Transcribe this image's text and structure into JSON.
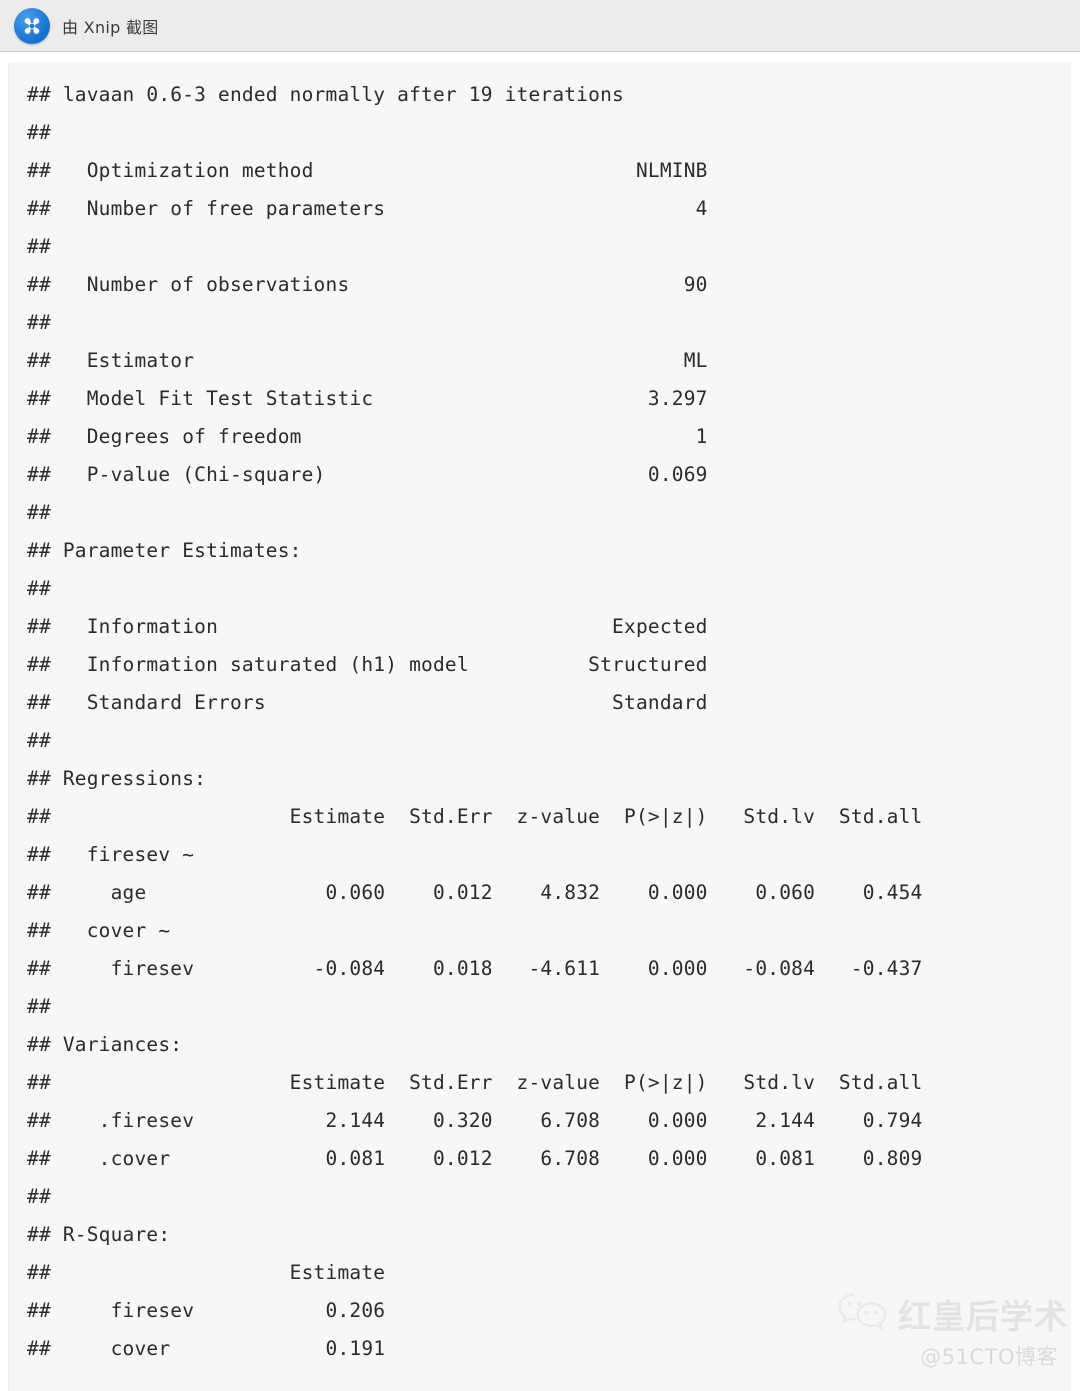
{
  "window": {
    "app_title": "由 Xnip 截图",
    "logo_icon": "xnip-scissors-icon",
    "header_bg": "#ececec",
    "code_bg": "#f7f7f7",
    "text_color": "#2b2b2b"
  },
  "console_output": {
    "language": "r",
    "comment_prefix": "##",
    "lines": [
      "## lavaan 0.6-3 ended normally after 19 iterations",
      "## ",
      "##   Optimization method                           NLMINB",
      "##   Number of free parameters                          4",
      "## ",
      "##   Number of observations                            90",
      "## ",
      "##   Estimator                                         ML",
      "##   Model Fit Test Statistic                       3.297",
      "##   Degrees of freedom                                 1",
      "##   P-value (Chi-square)                           0.069",
      "## ",
      "## Parameter Estimates:",
      "## ",
      "##   Information                                 Expected",
      "##   Information saturated (h1) model          Structured",
      "##   Standard Errors                             Standard",
      "## ",
      "## Regressions:",
      "##                    Estimate  Std.Err  z-value  P(>|z|)   Std.lv  Std.all",
      "##   firesev ~",
      "##     age               0.060    0.012    4.832    0.000    0.060    0.454",
      "##   cover ~",
      "##     firesev          -0.084    0.018   -4.611    0.000   -0.084   -0.437",
      "## ",
      "## Variances:",
      "##                    Estimate  Std.Err  z-value  P(>|z|)   Std.lv  Std.all",
      "##    .firesev           2.144    0.320    6.708    0.000    2.144    0.794",
      "##    .cover             0.081    0.012    6.708    0.000    0.081    0.809",
      "## ",
      "## R-Square:",
      "##                    Estimate",
      "##     firesev           0.206",
      "##     cover             0.191"
    ]
  },
  "model_summary": {
    "package": "lavaan",
    "version": "0.6-3",
    "convergence": "ended normally",
    "iterations": 19,
    "optimization_method": "NLMINB",
    "number_of_free_parameters": 4,
    "number_of_observations": 90,
    "estimator": "ML",
    "model_fit_test_statistic": 3.297,
    "degrees_of_freedom": 1,
    "p_value_chi_square": 0.069,
    "information": "Expected",
    "information_saturated_h1_model": "Structured",
    "standard_errors": "Standard"
  },
  "tables": {
    "regressions": {
      "heading": "Regressions:",
      "columns": [
        "Estimate",
        "Std.Err",
        "z-value",
        "P(>|z|)",
        "Std.lv",
        "Std.all"
      ],
      "groups": [
        {
          "label": "firesev ~",
          "rows": [
            {
              "name": "age",
              "values": [
                "0.060",
                "0.012",
                "4.832",
                "0.000",
                "0.060",
                "0.454"
              ]
            }
          ]
        },
        {
          "label": "cover ~",
          "rows": [
            {
              "name": "firesev",
              "values": [
                "-0.084",
                "0.018",
                "-4.611",
                "0.000",
                "-0.084",
                "-0.437"
              ]
            }
          ]
        }
      ]
    },
    "variances": {
      "heading": "Variances:",
      "columns": [
        "Estimate",
        "Std.Err",
        "z-value",
        "P(>|z|)",
        "Std.lv",
        "Std.all"
      ],
      "rows": [
        {
          "name": ".firesev",
          "values": [
            "2.144",
            "0.320",
            "6.708",
            "0.000",
            "2.144",
            "0.794"
          ]
        },
        {
          "name": ".cover",
          "values": [
            "0.081",
            "0.012",
            "6.708",
            "0.000",
            "0.081",
            "0.809"
          ]
        }
      ]
    },
    "r_square": {
      "heading": "R-Square:",
      "columns": [
        "Estimate"
      ],
      "rows": [
        {
          "name": "firesev",
          "values": [
            "0.206"
          ]
        },
        {
          "name": "cover",
          "values": [
            "0.191"
          ]
        }
      ]
    }
  },
  "watermark": {
    "brand": "红皇后学术",
    "source": "@51CTO博客",
    "chat_icon": "wechat-icon",
    "color": "#e2e2e2"
  }
}
